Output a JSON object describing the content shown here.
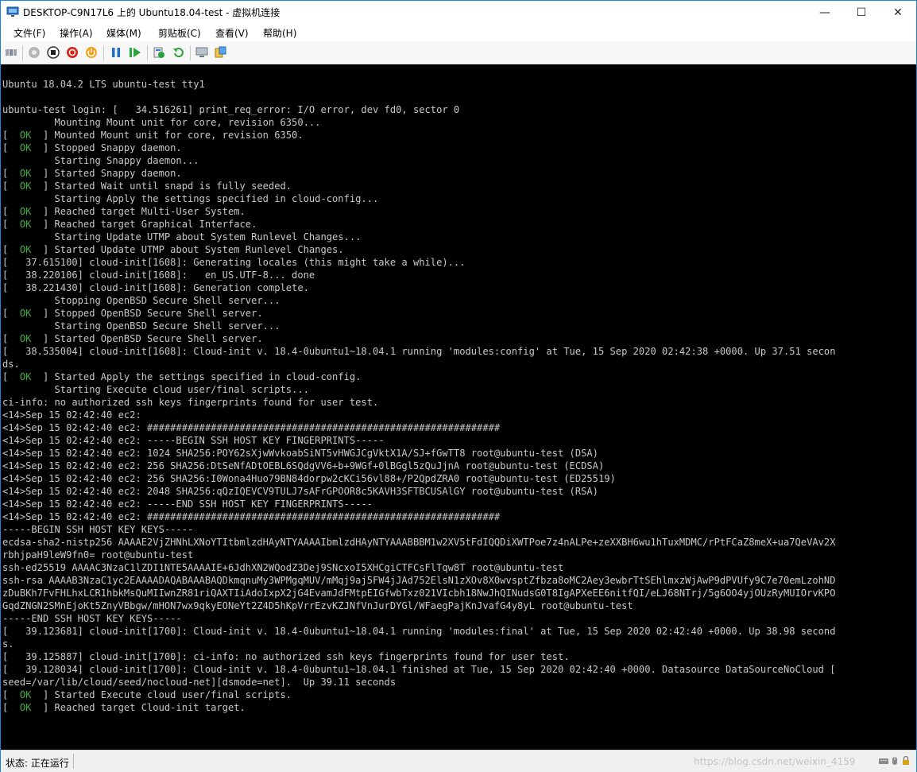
{
  "window": {
    "title": "DESKTOP-C9N17L6 上的 Ubuntu18.04-test - 虚拟机连接",
    "minimize": "—",
    "maximize": "☐",
    "close": "✕"
  },
  "menu": {
    "items": [
      "文件(F)",
      "操作(A)",
      "媒体(M)",
      "剪贴板(C)",
      "查看(V)",
      "帮助(H)"
    ]
  },
  "toolbar": {
    "icons": [
      "ctrl-alt-del-icon",
      "start-icon",
      "turn-off-icon",
      "shutdown-icon",
      "power-icon",
      "pause-icon",
      "resume-icon",
      "checkpoint-icon",
      "revert-icon",
      "enhanced-session-icon",
      "share-icon"
    ]
  },
  "console": {
    "lines": [
      "Ubuntu 18.04.2 LTS ubuntu-test tty1",
      "",
      "ubuntu-test login: [   34.516261] print_req_error: I/O error, dev fd0, sector 0",
      "         Mounting Mount unit for core, revision 6350...",
      "[  OK  ] Mounted Mount unit for core, revision 6350.",
      "[  OK  ] Stopped Snappy daemon.",
      "         Starting Snappy daemon...",
      "[  OK  ] Started Snappy daemon.",
      "[  OK  ] Started Wait until snapd is fully seeded.",
      "         Starting Apply the settings specified in cloud-config...",
      "[  OK  ] Reached target Multi-User System.",
      "[  OK  ] Reached target Graphical Interface.",
      "         Starting Update UTMP about System Runlevel Changes...",
      "[  OK  ] Started Update UTMP about System Runlevel Changes.",
      "[   37.615100] cloud-init[1608]: Generating locales (this might take a while)...",
      "[   38.220106] cloud-init[1608]:   en_US.UTF-8... done",
      "[   38.221430] cloud-init[1608]: Generation complete.",
      "         Stopping OpenBSD Secure Shell server...",
      "[  OK  ] Stopped OpenBSD Secure Shell server.",
      "         Starting OpenBSD Secure Shell server...",
      "[  OK  ] Started OpenBSD Secure Shell server.",
      "[   38.535004] cloud-init[1608]: Cloud-init v. 18.4-0ubuntu1~18.04.1 running 'modules:config' at Tue, 15 Sep 2020 02:42:38 +0000. Up 37.51 secon",
      "ds.",
      "[  OK  ] Started Apply the settings specified in cloud-config.",
      "         Starting Execute cloud user/final scripts...",
      "ci-info: no authorized ssh keys fingerprints found for user test.",
      "<14>Sep 15 02:42:40 ec2:",
      "<14>Sep 15 02:42:40 ec2: #############################################################",
      "<14>Sep 15 02:42:40 ec2: -----BEGIN SSH HOST KEY FINGERPRINTS-----",
      "<14>Sep 15 02:42:40 ec2: 1024 SHA256:POY62sXjwWvkoabSiNT5vHWGJCgVktX1A/SJ+fGwTT8 root@ubuntu-test (DSA)",
      "<14>Sep 15 02:42:40 ec2: 256 SHA256:DtSeNfADtOEBL6SQdgVV6+b+9WGf+0lBGgl5zQuJjnA root@ubuntu-test (ECDSA)",
      "<14>Sep 15 02:42:40 ec2: 256 SHA256:I0Wona4Huo79BN84dorpw2cKCi56vl88+/P2QpdZRA0 root@ubuntu-test (ED25519)",
      "<14>Sep 15 02:42:40 ec2: 2048 SHA256:qQzIQEVCV9TULJ7sAFrGPOOR8c5KAVH3SFTBCUSAlGY root@ubuntu-test (RSA)",
      "<14>Sep 15 02:42:40 ec2: -----END SSH HOST KEY FINGERPRINTS-----",
      "<14>Sep 15 02:42:40 ec2: #############################################################",
      "-----BEGIN SSH HOST KEY KEYS-----",
      "ecdsa-sha2-nistp256 AAAAE2VjZHNhLXNoYTItbmlzdHAyNTYAAAAIbmlzdHAyNTYAAABBBM1w2XV5tFdIQQDiXWTPoe7z4nALPe+zeXXBH6wu1hTuxMDMC/rPtFCaZ8meX+ua7QeVAv2X",
      "rbhjpaH9leW9fn0= root@ubuntu-test",
      "ssh-ed25519 AAAAC3NzaC1lZDI1NTE5AAAAIE+6JdhXN2WQodZ3Dej9SNcxoI5XHCgiCTFCsFlTqw8T root@ubuntu-test",
      "ssh-rsa AAAAB3NzaC1yc2EAAAADAQABAAABAQDkmqnuMy3WPMgqMUV/mMqj9aj5FW4jJAd752ElsN1zXOv8X0wvsptZfbza8oMC2Aey3ewbrTtSEhlmxzWjAwP9dPVUfy9C7e70emLzohND",
      "zDuBKh7FvFHLhxLCR1hbkMsQuMIIwnZR81riQAXTIiAdoIxpX2jG4EvamJdFMtpEIGfwbTxz021VIcbh18NwJhQINudsG0T8IgAPXeEE6nitfQI/eLJ68NTrj/5g6OO4yjOUzRyMUIOrvKPO",
      "GqdZNGN2SMnEjoKt5ZnyVBbgw/mHON7wx9qkyEONeYt2Z4D5hKpVrrEzvKZJNfVnJurDYGl/WFaegPajKnJvafG4y8yL root@ubuntu-test",
      "-----END SSH HOST KEY KEYS-----",
      "[   39.123681] cloud-init[1700]: Cloud-init v. 18.4-0ubuntu1~18.04.1 running 'modules:final' at Tue, 15 Sep 2020 02:42:40 +0000. Up 38.98 second",
      "s.",
      "[   39.125887] cloud-init[1700]: ci-info: no authorized ssh keys fingerprints found for user test.",
      "[   39.128034] cloud-init[1700]: Cloud-init v. 18.4-0ubuntu1~18.04.1 finished at Tue, 15 Sep 2020 02:42:40 +0000. Datasource DataSourceNoCloud [",
      "seed=/var/lib/cloud/seed/nocloud-net][dsmode=net].  Up 39.11 seconds",
      "[  OK  ] Started Execute cloud user/final scripts.",
      "[  OK  ] Reached target Cloud-init target."
    ],
    "ok_color": "#3fb43f",
    "text_color": "#c8c8c8"
  },
  "status": {
    "label": "状态: 正在运行",
    "watermark": "https://blog.csdn.net/weixin_4159"
  }
}
